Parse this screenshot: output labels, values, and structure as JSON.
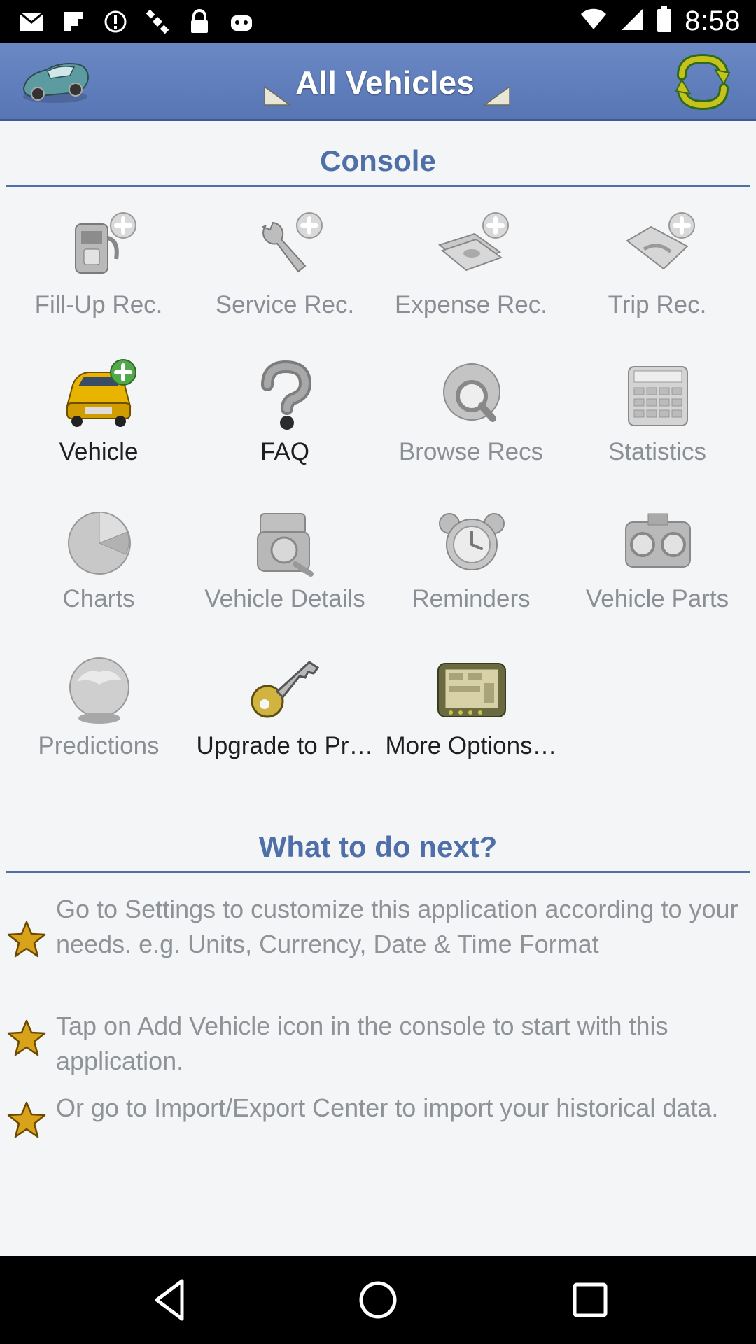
{
  "status_bar": {
    "time": "8:58",
    "left_icons": [
      "email-icon",
      "flipboard-icon",
      "alert-icon",
      "satellite-icon",
      "lock-icon",
      "android-icon"
    ],
    "right_icons": [
      "wifi-icon",
      "signal-icon",
      "battery-icon"
    ]
  },
  "app_bar": {
    "title": "All Vehicles",
    "left_icon": "car-icon",
    "right_icon": "refresh-icon",
    "accent_color": "#5b79b8"
  },
  "console": {
    "title": "Console",
    "items": [
      {
        "label": "Fill-Up Rec.",
        "icon": "fuel-pump-add-icon",
        "enabled": false
      },
      {
        "label": "Service Rec.",
        "icon": "wrench-add-icon",
        "enabled": false
      },
      {
        "label": "Expense Rec.",
        "icon": "money-add-icon",
        "enabled": false
      },
      {
        "label": "Trip Rec.",
        "icon": "map-add-icon",
        "enabled": false
      },
      {
        "label": "Vehicle",
        "icon": "car-add-icon",
        "enabled": true
      },
      {
        "label": "FAQ",
        "icon": "question-icon",
        "enabled": true
      },
      {
        "label": "Browse Recs",
        "icon": "magnifier-icon",
        "enabled": false
      },
      {
        "label": "Statistics",
        "icon": "calculator-icon",
        "enabled": false
      },
      {
        "label": "Charts",
        "icon": "pie-chart-icon",
        "enabled": false
      },
      {
        "label": "Vehicle Details",
        "icon": "engine-icon",
        "enabled": false
      },
      {
        "label": "Reminders",
        "icon": "alarm-clock-icon",
        "enabled": false
      },
      {
        "label": "Vehicle Parts",
        "icon": "car-parts-icon",
        "enabled": false
      },
      {
        "label": "Predictions",
        "icon": "crystal-ball-icon",
        "enabled": false
      },
      {
        "label": "Upgrade to Pr…",
        "icon": "key-icon",
        "enabled": true
      },
      {
        "label": "More Options…",
        "icon": "options-panel-icon",
        "enabled": true
      }
    ]
  },
  "next_steps": {
    "title": "What to do next?",
    "tips": [
      "Go to Settings to customize this application according to your needs. e.g. Units, Currency, Date & Time Format",
      "Tap on Add Vehicle icon in the console to start with this application.",
      "Or go to Import/Export Center to import your historical data."
    ]
  },
  "nav_bar": {
    "icons": [
      "back-icon",
      "home-icon",
      "recents-icon"
    ]
  }
}
